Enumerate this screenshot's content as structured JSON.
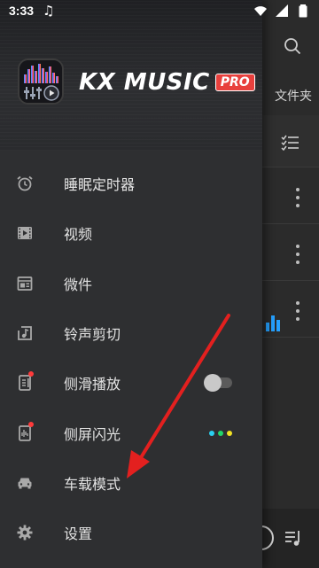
{
  "status_bar": {
    "time": "3:33",
    "icons": [
      "music-note-icon",
      "wifi-icon",
      "signal-icon",
      "battery-icon"
    ]
  },
  "background_pane": {
    "folder_tab": "文件夹",
    "icons": [
      "search-icon",
      "list-check-icon",
      "more-icon",
      "equalizer-icon",
      "play-circle-icon",
      "queue-icon"
    ]
  },
  "drawer": {
    "brand": {
      "name": "KX MUSIC",
      "badge": "PRO"
    },
    "menu": [
      {
        "id": "sleep-timer",
        "label": "睡眠定时器",
        "icon": "alarm-icon",
        "new_dot": false,
        "control": null
      },
      {
        "id": "video",
        "label": "视频",
        "icon": "video-icon",
        "new_dot": false,
        "control": null
      },
      {
        "id": "widget",
        "label": "微件",
        "icon": "widget-icon",
        "new_dot": false,
        "control": null
      },
      {
        "id": "ringtone-cutter",
        "label": "铃声剪切",
        "icon": "ringtone-icon",
        "new_dot": false,
        "control": null
      },
      {
        "id": "edge-swipe",
        "label": "侧滑播放",
        "icon": "edge-swipe-icon",
        "new_dot": true,
        "control": "toggle-off"
      },
      {
        "id": "edge-lighting",
        "label": "侧屏闪光",
        "icon": "edge-light-icon",
        "new_dot": true,
        "control": "color-dots"
      },
      {
        "id": "car-mode",
        "label": "车载模式",
        "icon": "car-icon",
        "new_dot": false,
        "control": null
      },
      {
        "id": "settings",
        "label": "设置",
        "icon": "gear-icon",
        "new_dot": false,
        "control": null
      }
    ],
    "edge_light_colors": [
      "#2ad1f0",
      "#22d66b",
      "#f2e224"
    ]
  },
  "colors": {
    "drawer_bg": "#2e2f31",
    "accent_red": "#e8403d",
    "annotation_arrow": "#e3201f"
  }
}
